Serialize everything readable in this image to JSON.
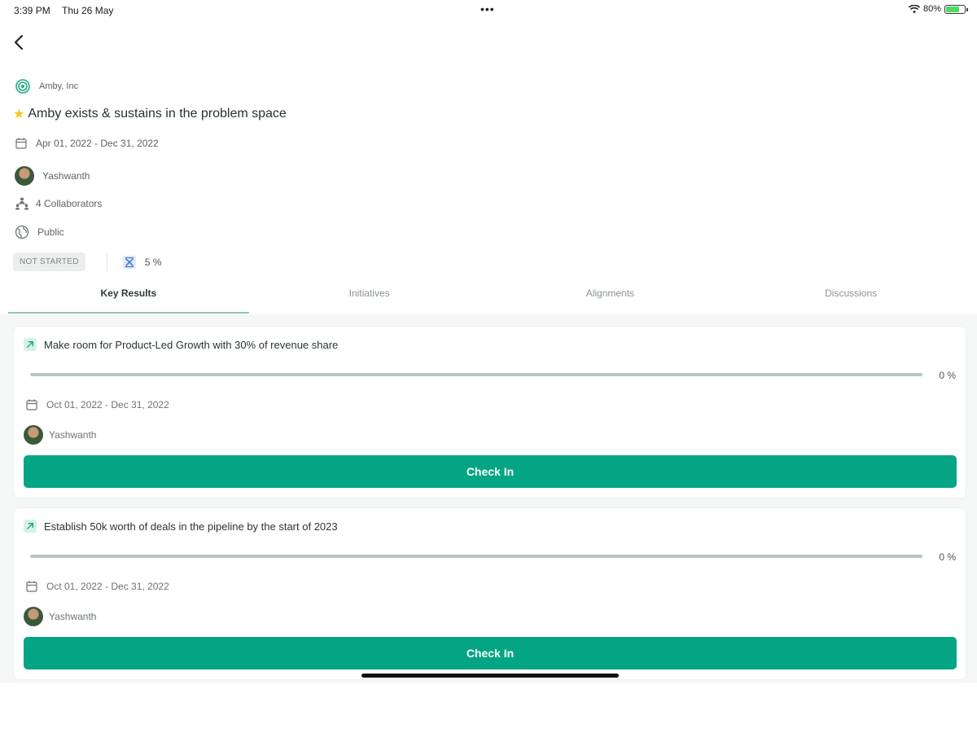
{
  "status_bar": {
    "time": "3:39 PM",
    "date": "Thu 26 May",
    "dots": "•••",
    "battery": "80%",
    "battery_level": 0.8
  },
  "objective": {
    "organization": "Amby, Inc",
    "title": "Amby exists & sustains in the problem space",
    "date_range": "Apr 01, 2022 - Dec 31, 2022",
    "owner": "Yashwanth",
    "collaborators": "4 Collaborators",
    "visibility": "Public",
    "status": "NOT STARTED",
    "progress_label": "5 %",
    "progress": 0.05
  },
  "tabs": [
    {
      "label": "Key Results",
      "active": true
    },
    {
      "label": "Initiatives",
      "active": false
    },
    {
      "label": "Alignments",
      "active": false
    },
    {
      "label": "Discussions",
      "active": false
    }
  ],
  "key_results": [
    {
      "title": "Make room for Product-Led Growth with 30% of revenue share",
      "progress_label": "0 %",
      "progress": 0,
      "date_range": "Oct 01, 2022 - Dec 31, 2022",
      "owner": "Yashwanth",
      "button_label": "Check In"
    },
    {
      "title": "Establish 50k worth of deals in the pipeline by the start of 2023",
      "progress_label": "0 %",
      "progress": 0,
      "date_range": "Oct 01, 2022 - Dec 31, 2022",
      "owner": "Yashwanth",
      "button_label": "Check In"
    }
  ],
  "colors": {
    "accent": "#04a584",
    "tab_underline": "#8fc7b5",
    "badge_bg": "#eceeee"
  },
  "icons": {
    "back": "chevron-left-icon",
    "org": "target-icon",
    "calendar": "calendar-icon",
    "collaborators": "people-hierarchy-icon",
    "visibility": "globe-icon",
    "progress": "progress-cross-icon",
    "kr": "arrow-up-right-icon"
  }
}
